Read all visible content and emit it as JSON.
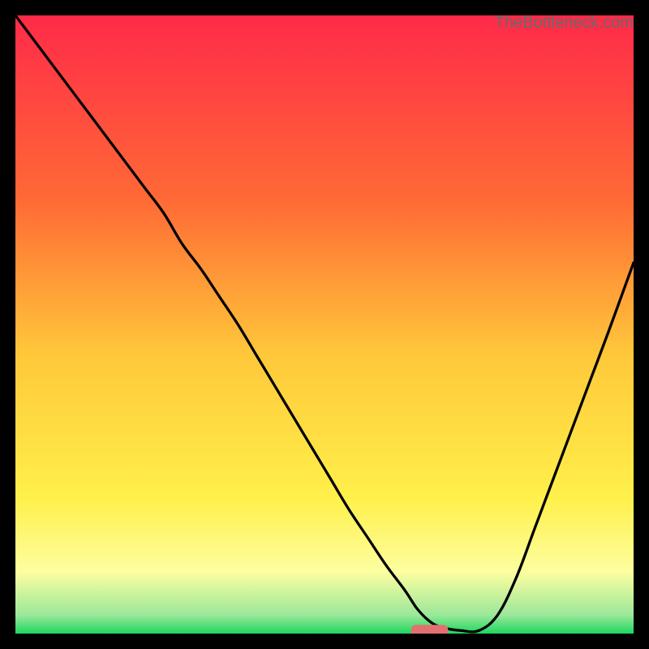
{
  "watermark": "TheBottleneck.com",
  "colors": {
    "frame": "#000000",
    "gradient_top": "#ff2a49",
    "gradient_upper_mid": "#ff8a2c",
    "gradient_mid": "#ffd83a",
    "gradient_lower_mid": "#fff66a",
    "gradient_bottom": "#1ed760",
    "curve": "#000000",
    "marker_fill": "#e37070",
    "marker_stroke": "#e37070"
  },
  "chart_data": {
    "type": "line",
    "title": "",
    "xlabel": "",
    "ylabel": "",
    "xlim": [
      0,
      100
    ],
    "ylim": [
      0,
      100
    ],
    "x": [
      0,
      3,
      6,
      9,
      12,
      15,
      18,
      21,
      24,
      27,
      30,
      33,
      36,
      39,
      42,
      45,
      48,
      51,
      54,
      57,
      60,
      63,
      65,
      67,
      69,
      72,
      75,
      78,
      81,
      84,
      87,
      90,
      93,
      96,
      100
    ],
    "values": [
      100,
      96,
      92,
      88,
      84,
      80,
      76,
      72,
      68,
      63,
      59,
      54.5,
      50,
      45,
      40,
      35,
      30,
      25,
      20,
      15.5,
      11,
      7,
      4,
      2,
      1,
      0.5,
      0.5,
      3,
      9,
      17,
      25,
      33,
      41,
      49,
      60
    ],
    "marker": {
      "x_center": 67,
      "width_pct": 6,
      "y_value": 0.5
    }
  }
}
